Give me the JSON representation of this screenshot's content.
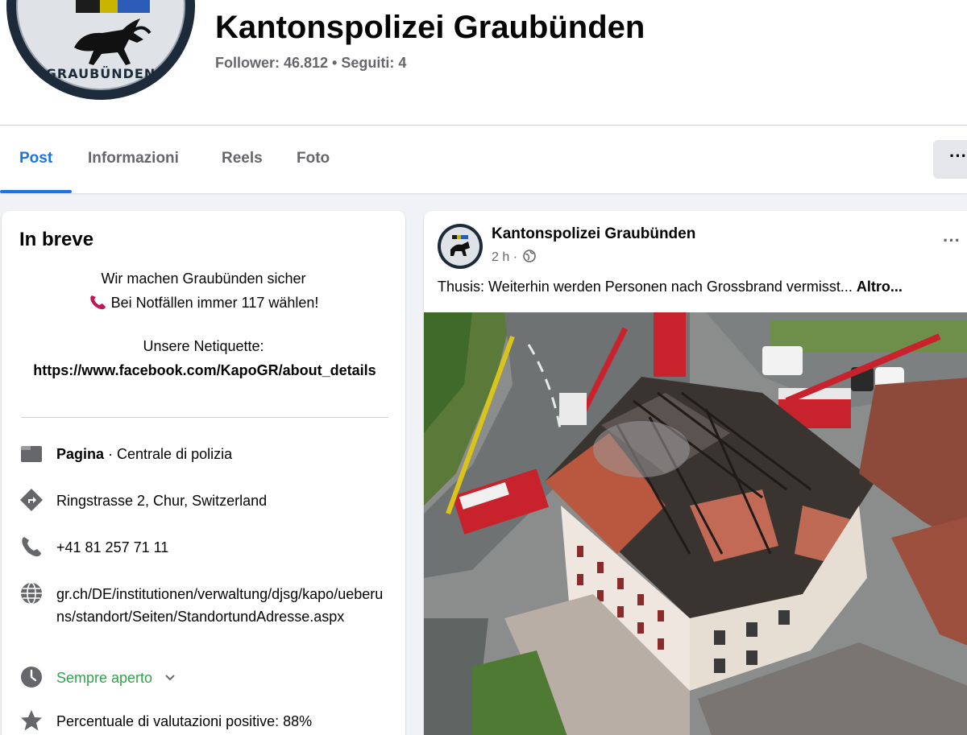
{
  "header": {
    "page_title": "Kantonspolizei Graubünden",
    "stats": "Follower: 46.812 • Seguiti: 4",
    "logo_text": "GRAUBÜNDEN"
  },
  "tabs": [
    {
      "label": "Post",
      "active": true
    },
    {
      "label": "Informazioni",
      "active": false
    },
    {
      "label": "Reels",
      "active": false
    },
    {
      "label": "Foto",
      "active": false
    }
  ],
  "more_label": "···",
  "intro": {
    "title": "In breve",
    "bio_line1": "Wir machen Graubünden sicher",
    "bio_line2": "Bei Notfällen immer 117 wählen!",
    "bio_line3": "Unsere Netiquette:",
    "bio_link": "https://www.facebook.com/KapoGR/about_details",
    "category_type": "Pagina",
    "category_value": " · Centrale di polizia",
    "address": "Ringstrasse 2, Chur, Switzerland",
    "phone": "+41 81 257 71 11",
    "website": "gr.ch/DE/institutionen/verwaltung/djsg/kapo/ueberuns/standort/Seiten/StandortundAdresse.aspx",
    "hours": "Sempre aperto",
    "rating": "Percentuale di valutazioni positive: 88%"
  },
  "post": {
    "author": "Kantonspolizei Graubünden",
    "time": "2 h ·",
    "dots": "···",
    "text": "Thusis: Weiterhin werden Personen nach Grossbrand vermisst...",
    "more": "Altro..."
  },
  "colors": {
    "accent": "#1b74e4",
    "green": "#31a24c",
    "secondary_text": "#65676b"
  }
}
